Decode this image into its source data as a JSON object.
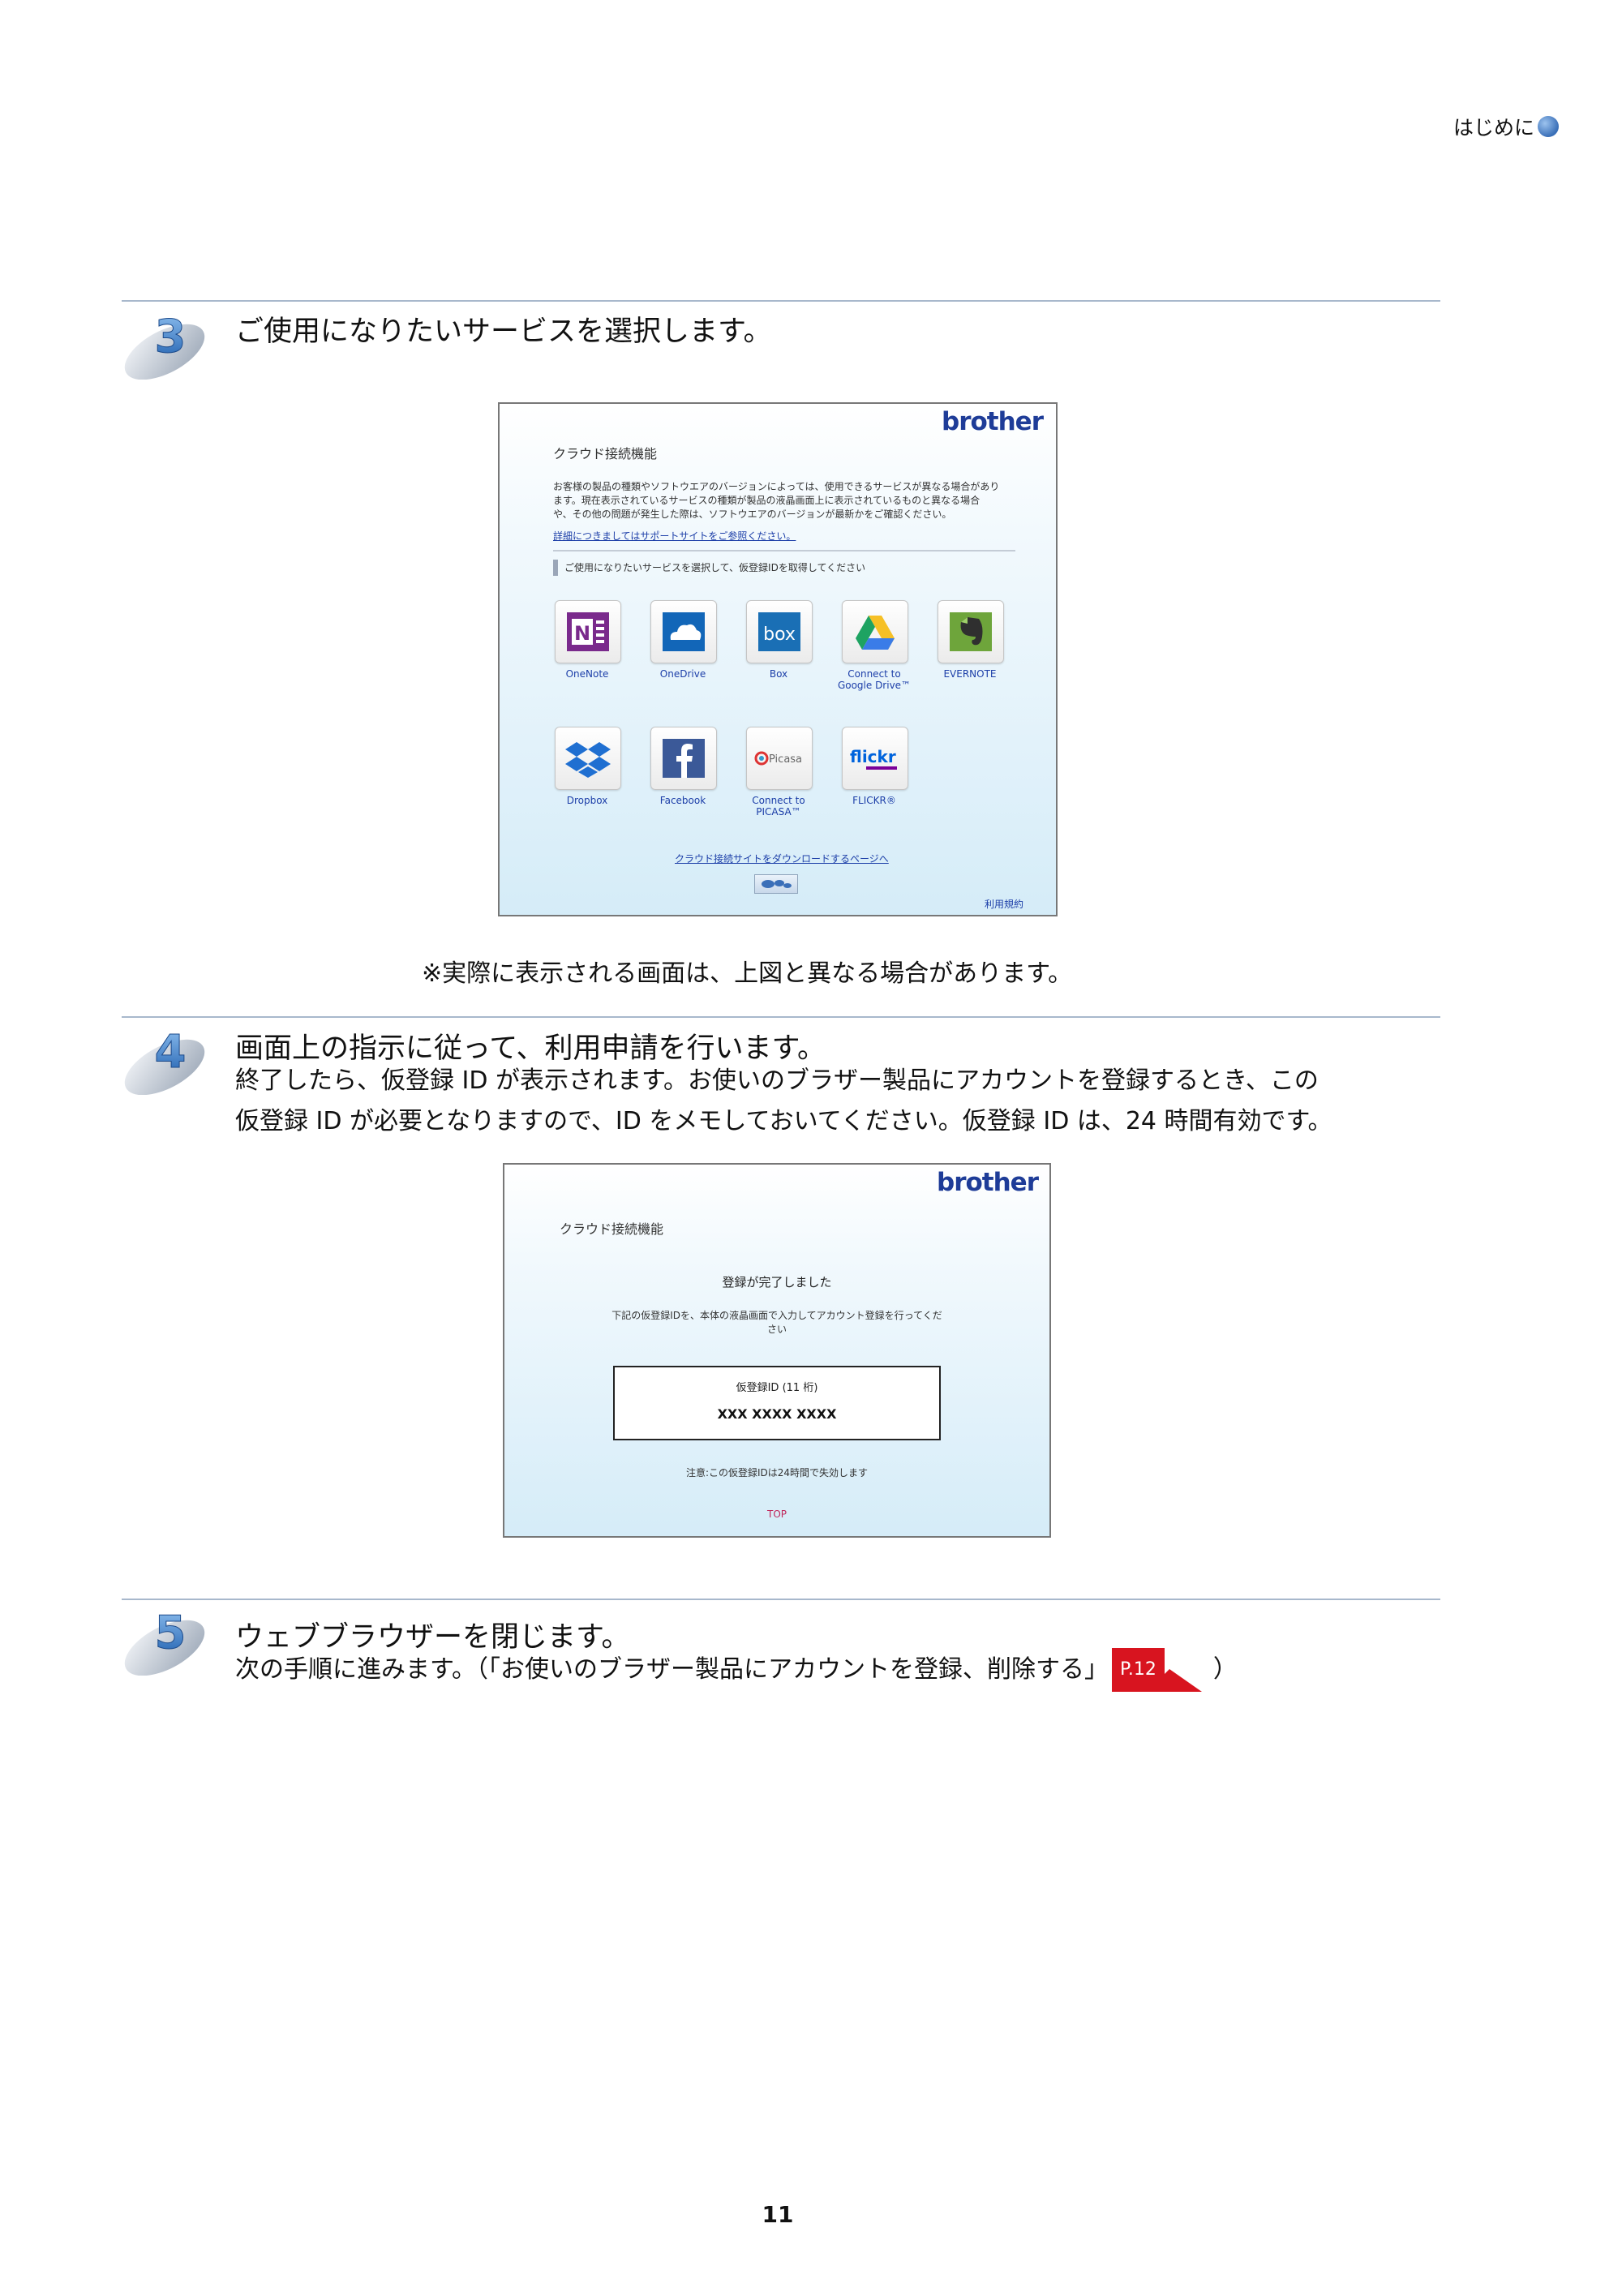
{
  "header": {
    "section": "はじめに"
  },
  "steps": [
    {
      "number": "3",
      "title": "ご使用になりたいサービスを選択します。"
    },
    {
      "number": "4",
      "title": "画面上の指示に従って、利用申請を行います。",
      "body": [
        "終了したら、仮登録 ID が表示されます。お使いのブラザー製品にアカウントを登録するとき、この",
        "仮登録 ID が必要となりますので、ID をメモしておいてください。仮登録 ID は、24 時間有効です。"
      ]
    },
    {
      "number": "5",
      "title": "ウェブブラウザーを閉じます。",
      "body_prefix": "次の手順に進みます。（「お使いのブラザー製品にアカウントを登録、削除する」",
      "xref": "P.12",
      "body_suffix": "）"
    }
  ],
  "screen1": {
    "logo": "brother",
    "heading": "クラウド接続機能",
    "description": [
      "お客様の製品の種類やソフトウエアのバージョンによっては、使用できるサービスが異なる場合があり",
      "ます。現在表示されているサービスの種類が製品の液晶画面上に表示されているものと異なる場合",
      "や、その他の問題が発生した際は、ソフトウエアのバージョンが最新かをご確認ください。"
    ],
    "support_link": "詳細につきましてはサポートサイトをご参照ください。",
    "instruction": "ご使用になりたいサービスを選択して、仮登録IDを取得してください",
    "services": [
      {
        "label": "OneNote",
        "icon": "onenote-icon"
      },
      {
        "label": "OneDrive",
        "icon": "onedrive-icon"
      },
      {
        "label": "Box",
        "icon": "box-icon"
      },
      {
        "label": "Connect to\nGoogle Drive™",
        "icon": "google-drive-icon"
      },
      {
        "label": "EVERNOTE",
        "icon": "evernote-icon"
      },
      {
        "label": "Dropbox",
        "icon": "dropbox-icon"
      },
      {
        "label": "Facebook",
        "icon": "facebook-icon"
      },
      {
        "label": "Connect to\nPICASA™",
        "icon": "picasa-icon"
      },
      {
        "label": "FLICKR®",
        "icon": "flickr-icon"
      }
    ],
    "box_text": "box",
    "flickr_text": "flickr",
    "picasa_text": "Picasa",
    "download_link": "クラウド接続サイトをダウンロードするページへ",
    "terms_link": "利用規約"
  },
  "notice": "※実際に表示される画面は、上図と異なる場合があります。",
  "screen2": {
    "logo": "brother",
    "heading": "クラウド接続機能",
    "complete": "登録が完了しました",
    "instruction": [
      "下記の仮登録IDを、本体の液晶画面で入力してアカウント登録を行ってくだ",
      "さい"
    ],
    "id_label": "仮登録ID (11 桁)",
    "id_value": "XXX XXXX XXXX",
    "note": "注意:この仮登録IDは24時間で失効します",
    "top_link": "TOP"
  },
  "page_number": "11",
  "colors": {
    "accent_blue": "#3a6fb8",
    "xref_red": "#d8141f",
    "brother_blue": "#1e3c98"
  }
}
